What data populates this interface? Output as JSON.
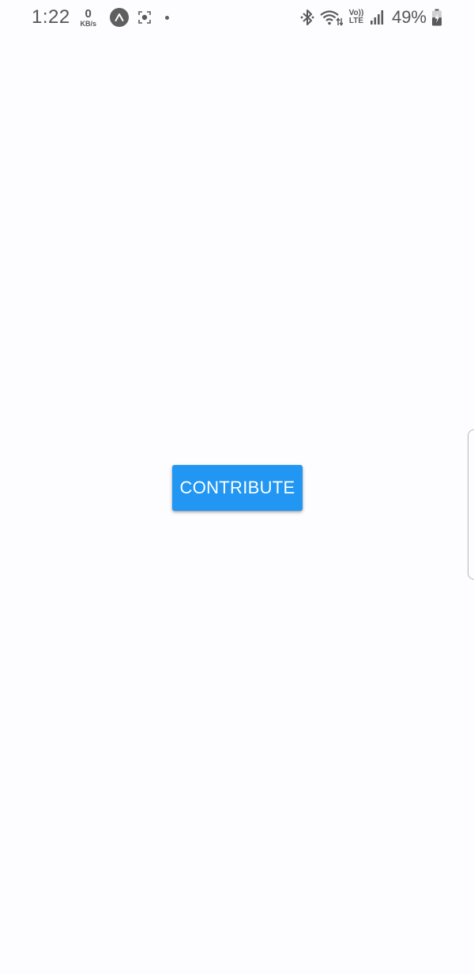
{
  "status_bar": {
    "time": "1:22",
    "net_speed_value": "0",
    "net_speed_unit": "KB/s",
    "icons_left": [
      "app-notification-icon",
      "screenshot-icon",
      "more-notifications-dot-icon"
    ],
    "icons_right": [
      "bluetooth-icon",
      "wifi-icon",
      "volte-icon",
      "signal-icon",
      "battery-icon"
    ],
    "volte_top": "Vo))",
    "volte_bottom": "LTE",
    "battery_percent": "49%"
  },
  "main": {
    "contribute_label": "CONTRIBUTE"
  },
  "colors": {
    "background": "#fdfcfe",
    "button_bg": "#2196f3",
    "button_text": "#ffffff",
    "status_icons": "#555555"
  }
}
